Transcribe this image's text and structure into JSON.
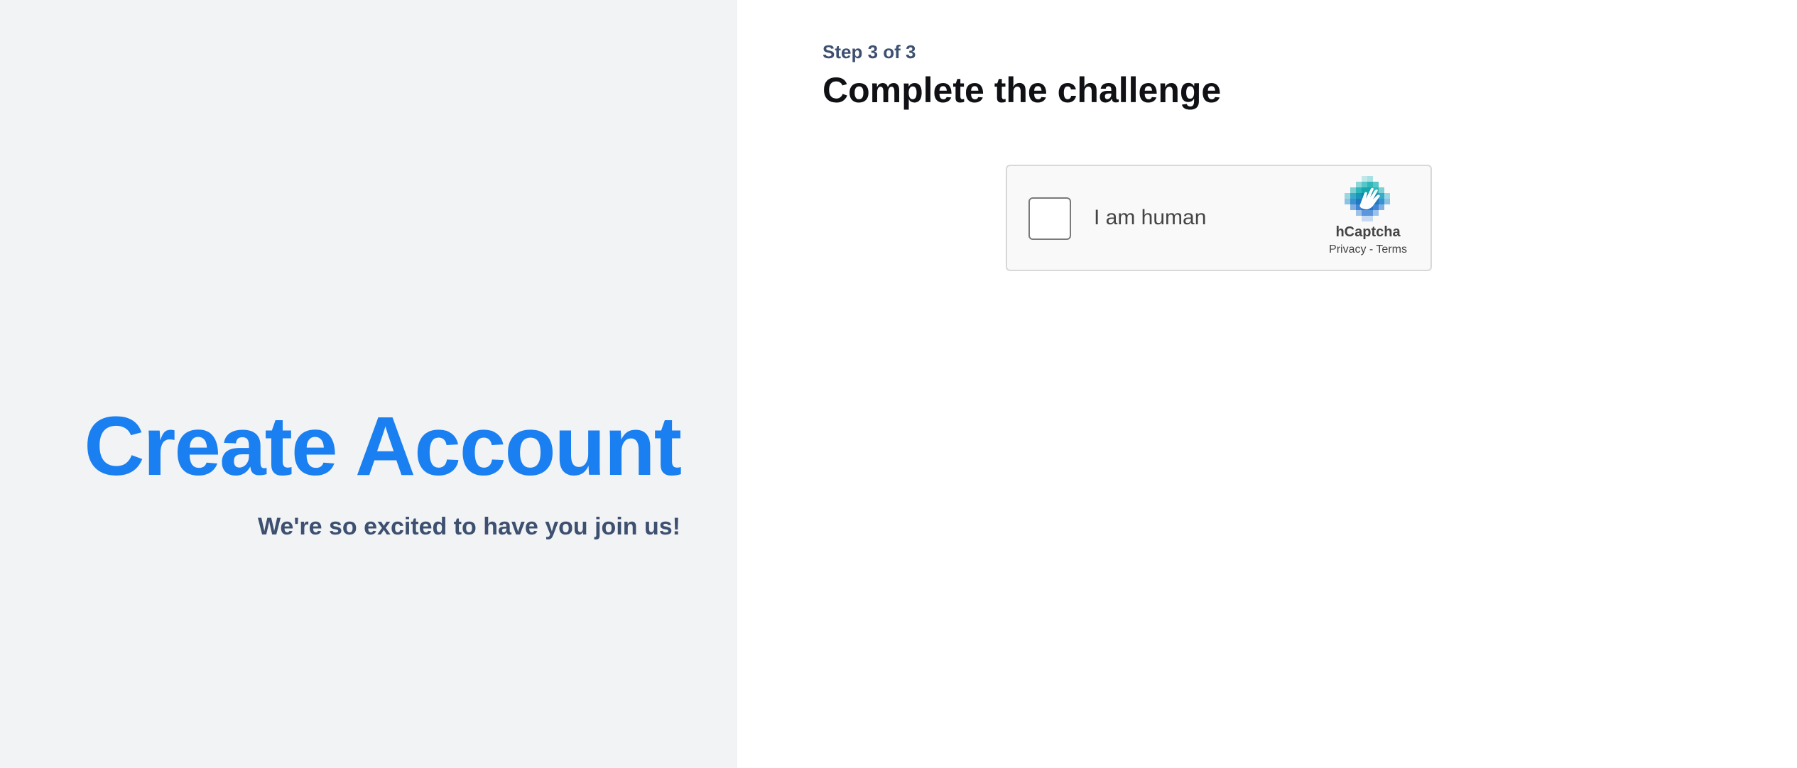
{
  "hero": {
    "title": "Create Account",
    "subtitle": "We're so excited to have you join us!"
  },
  "step": {
    "label": "Step 3 of 3",
    "title": "Complete the challenge"
  },
  "captcha": {
    "checkbox_label": "I am human",
    "brand": "hCaptcha",
    "privacy_link": "Privacy",
    "separator": " - ",
    "terms_link": "Terms",
    "icon": "hcaptcha-logo-icon",
    "checked": false
  },
  "colors": {
    "accent": "#1a7ff0",
    "subtitle": "#3d5070",
    "heading": "#0f1115",
    "left_panel_bg": "#f1f3f5"
  }
}
